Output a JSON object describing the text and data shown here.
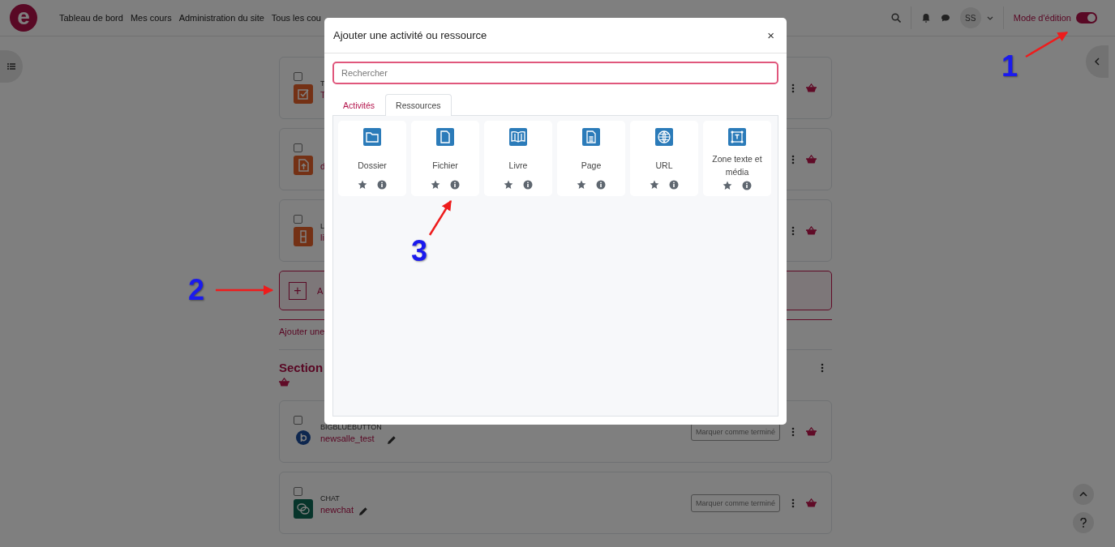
{
  "navbar": {
    "logo_text": "e",
    "links": [
      {
        "label": "Tableau de bord"
      },
      {
        "label": "Mes cours"
      },
      {
        "label": "Administration du site"
      },
      {
        "label": "Tous les cou"
      }
    ],
    "user": {
      "initials": "SS"
    },
    "edit_mode": {
      "label": "Mode d'édition",
      "on": true
    }
  },
  "course": {
    "activities": [
      {
        "kind": "assign",
        "type": "T",
        "name": "T",
        "checked": false
      },
      {
        "kind": "upload",
        "name": "d",
        "checked": false
      },
      {
        "kind": "lesson",
        "type": "L",
        "name": "li",
        "checked": false
      }
    ],
    "add_box": {
      "symbol": "+",
      "label": "A"
    },
    "add_link": "Ajouter une",
    "section": {
      "title": "Section"
    },
    "section_activities": [
      {
        "kind": "bbb",
        "type": "BIGBLUEBUTTON",
        "name": "newsalle_test",
        "checked": false,
        "completion": "Marquer comme terminé"
      },
      {
        "kind": "chat",
        "type": "CHAT",
        "name": "newchat",
        "checked": false,
        "completion": "Marquer comme terminé"
      }
    ]
  },
  "modal": {
    "title": "Ajouter une activité ou ressource",
    "close": "×",
    "search": {
      "placeholder": "Rechercher"
    },
    "tabs": [
      {
        "label": "Activités",
        "selected": false
      },
      {
        "label": "Ressources",
        "selected": true
      }
    ],
    "tiles": [
      {
        "kind": "folder",
        "name": "Dossier",
        "starred": false
      },
      {
        "kind": "file",
        "name": "Fichier",
        "starred": false
      },
      {
        "kind": "book",
        "name": "Livre",
        "starred": false
      },
      {
        "kind": "page",
        "name": "Page",
        "starred": false
      },
      {
        "kind": "globe",
        "name": "URL",
        "starred": false
      },
      {
        "kind": "textmedia",
        "name": "Zone texte et média",
        "starred": false
      }
    ]
  },
  "annotations": [
    {
      "label": "1"
    },
    {
      "label": "2"
    },
    {
      "label": "3"
    }
  ]
}
